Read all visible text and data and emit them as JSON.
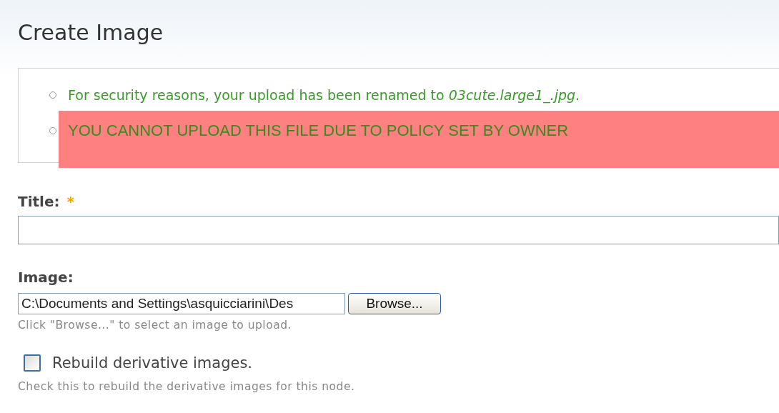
{
  "page": {
    "title": "Create Image"
  },
  "messages": [
    {
      "kind": "status",
      "text": "For security reasons, your upload has been renamed to *03cute.large1_.jpg*."
    },
    {
      "kind": "alert",
      "text": "YOU CANNOT UPLOAD THIS FILE DUE TO POLICY SET BY OWNER"
    }
  ],
  "title_field": {
    "label": "Title:",
    "required_mark": "*"
  },
  "image_field": {
    "label": "Image:",
    "value": "C:\\Documents and Settings\\asquicciarini\\Des",
    "button": "Browse...",
    "help": "Click \"Browse...\" to select an image to upload."
  },
  "rebuild": {
    "label": "Rebuild derivative images.",
    "checked": false,
    "help": "Check this to rebuild the derivative images for this node."
  }
}
